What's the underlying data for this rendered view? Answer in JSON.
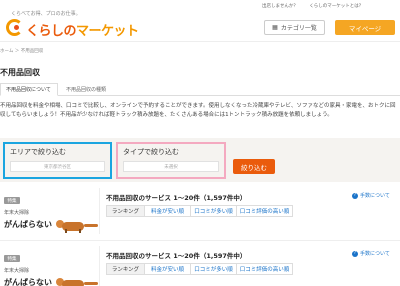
{
  "header": {
    "tagline": "くらべてお得、プロのお仕事。",
    "logo_prefix": "くらしの",
    "logo_main": "マーケット",
    "top_links": [
      "出店しませんか？",
      "くらしのマーケットとは？"
    ],
    "category_button": "カテゴリ一覧",
    "mypage_button": "マイページ"
  },
  "breadcrumb": "ホーム ＞ 不用品回収",
  "page_title": "不用品回収",
  "tabs": [
    "不用品回収について",
    "不用品回収の種類"
  ],
  "intro": "不用品回収を料金や相場、口コミで比較し、オンラインで予約することができます。使用しなくなった冷蔵庫やテレビ、ソファなどの家具・家電を、おトクに回収してもらいましょう！不用品が少なければ軽トラック積み放題を、たくさんある場合には1トントラック積み放題を依頼しましょう。",
  "filters": {
    "area_label": "エリアで絞り込む",
    "area_placeholder": "東京都渋谷区",
    "type_label": "タイプで絞り込む",
    "type_placeholder": "未選択",
    "submit": "絞り込む"
  },
  "listings": [
    {
      "badge": "特集",
      "sub": "年末大掃除",
      "name": "がんばらない",
      "count": "不用品回収のサービス 1～20件（1,597件中）",
      "review_link": "手数について",
      "sort_tabs": [
        "ランキング",
        "料金が安い順",
        "口コミが多い順",
        "口コミ評価の高い順"
      ]
    },
    {
      "badge": "特集",
      "sub": "年末大掃除",
      "name": "がんばらない",
      "count": "不用品回収のサービス 1～20件（1,597件中）",
      "review_link": "手数について",
      "sort_tabs": [
        "ランキング",
        "料金が安い順",
        "口コミが多い順",
        "口コミ評価の高い順"
      ]
    }
  ],
  "colors": {
    "accent_orange": "#ea5b0c",
    "mypage_yellow": "#f5a623",
    "area_border": "#1ba5e0",
    "type_border": "#f4a9c0",
    "link_blue": "#1a73c9"
  },
  "icons": [
    "grid-icon",
    "info-icon"
  ]
}
